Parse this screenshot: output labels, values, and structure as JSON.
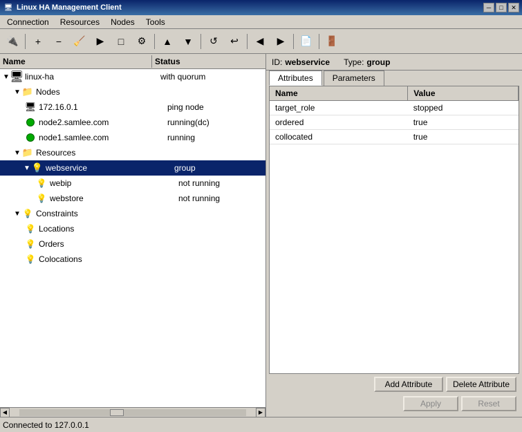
{
  "titleBar": {
    "title": "Linux HA Management Client",
    "icon": "⚙",
    "minimizeBtn": "─",
    "maximizeBtn": "□",
    "closeBtn": "✕"
  },
  "menuBar": {
    "items": [
      "Connection",
      "Resources",
      "Nodes",
      "Tools"
    ]
  },
  "toolbar": {
    "buttons": [
      {
        "name": "plug-icon",
        "symbol": "🔌"
      },
      {
        "name": "add-icon",
        "symbol": "+"
      },
      {
        "name": "remove-icon",
        "symbol": "−"
      },
      {
        "name": "clean-icon",
        "symbol": "🧹"
      },
      {
        "name": "play-icon",
        "symbol": "▶"
      },
      {
        "name": "stop-icon",
        "symbol": "□"
      },
      {
        "name": "settings-icon",
        "symbol": "⚙"
      },
      {
        "name": "up-icon",
        "symbol": "▲"
      },
      {
        "name": "down-icon",
        "symbol": "▼"
      },
      {
        "name": "refresh-icon",
        "symbol": "↺"
      },
      {
        "name": "undo-icon",
        "symbol": "↩"
      },
      {
        "name": "left-icon",
        "symbol": "◀"
      },
      {
        "name": "right-icon",
        "symbol": "▶"
      },
      {
        "name": "doc-icon",
        "symbol": "📄"
      },
      {
        "name": "exit-icon",
        "symbol": "🚪"
      }
    ]
  },
  "treeHeader": {
    "nameLabel": "Name",
    "statusLabel": "Status"
  },
  "tree": {
    "items": [
      {
        "id": "linux-ha",
        "label": "linux-ha",
        "status": "with quorum",
        "level": 0,
        "type": "root",
        "expanded": true,
        "toggle": "▼"
      },
      {
        "id": "nodes",
        "label": "Nodes",
        "status": "",
        "level": 1,
        "type": "folder",
        "expanded": true,
        "toggle": "▼"
      },
      {
        "id": "172.16.0.1",
        "label": "172.16.0.1",
        "status": "ping node",
        "level": 2,
        "type": "monitor"
      },
      {
        "id": "node2",
        "label": "node2.samlee.com",
        "status": "running(dc)",
        "level": 2,
        "type": "node-green"
      },
      {
        "id": "node1",
        "label": "node1.samlee.com",
        "status": "running",
        "level": 2,
        "type": "node-green"
      },
      {
        "id": "resources",
        "label": "Resources",
        "status": "",
        "level": 1,
        "type": "folder",
        "expanded": true,
        "toggle": "▼"
      },
      {
        "id": "webservice",
        "label": "webservice",
        "status": "group",
        "level": 2,
        "type": "group",
        "expanded": true,
        "toggle": "▼",
        "selected": true
      },
      {
        "id": "webip",
        "label": "webip",
        "status": "not running",
        "level": 3,
        "type": "bulb"
      },
      {
        "id": "webstore",
        "label": "webstore",
        "status": "not running",
        "level": 3,
        "type": "bulb"
      },
      {
        "id": "constraints",
        "label": "Constraints",
        "status": "",
        "level": 1,
        "type": "folder",
        "expanded": true,
        "toggle": "▼"
      },
      {
        "id": "locations",
        "label": "Locations",
        "status": "",
        "level": 2,
        "type": "bulb"
      },
      {
        "id": "orders",
        "label": "Orders",
        "status": "",
        "level": 2,
        "type": "bulb"
      },
      {
        "id": "colocations",
        "label": "Colocations",
        "status": "",
        "level": 2,
        "type": "bulb"
      }
    ]
  },
  "rightPanel": {
    "idLabel": "ID:",
    "idValue": "webservice",
    "typeLabel": "Type:",
    "typeValue": "group",
    "tabs": [
      {
        "id": "attributes",
        "label": "Attributes",
        "active": true
      },
      {
        "id": "parameters",
        "label": "Parameters",
        "active": false
      }
    ],
    "attributesTable": {
      "columns": [
        "Name",
        "Value"
      ],
      "rows": [
        {
          "name": "target_role",
          "value": "stopped"
        },
        {
          "name": "ordered",
          "value": "true"
        },
        {
          "name": "collocated",
          "value": "true"
        }
      ]
    },
    "buttons": {
      "addAttribute": "Add Attribute",
      "deleteAttribute": "Delete Attribute",
      "apply": "Apply",
      "reset": "Reset"
    }
  },
  "statusBar": {
    "text": "Connected to 127.0.0.1"
  }
}
